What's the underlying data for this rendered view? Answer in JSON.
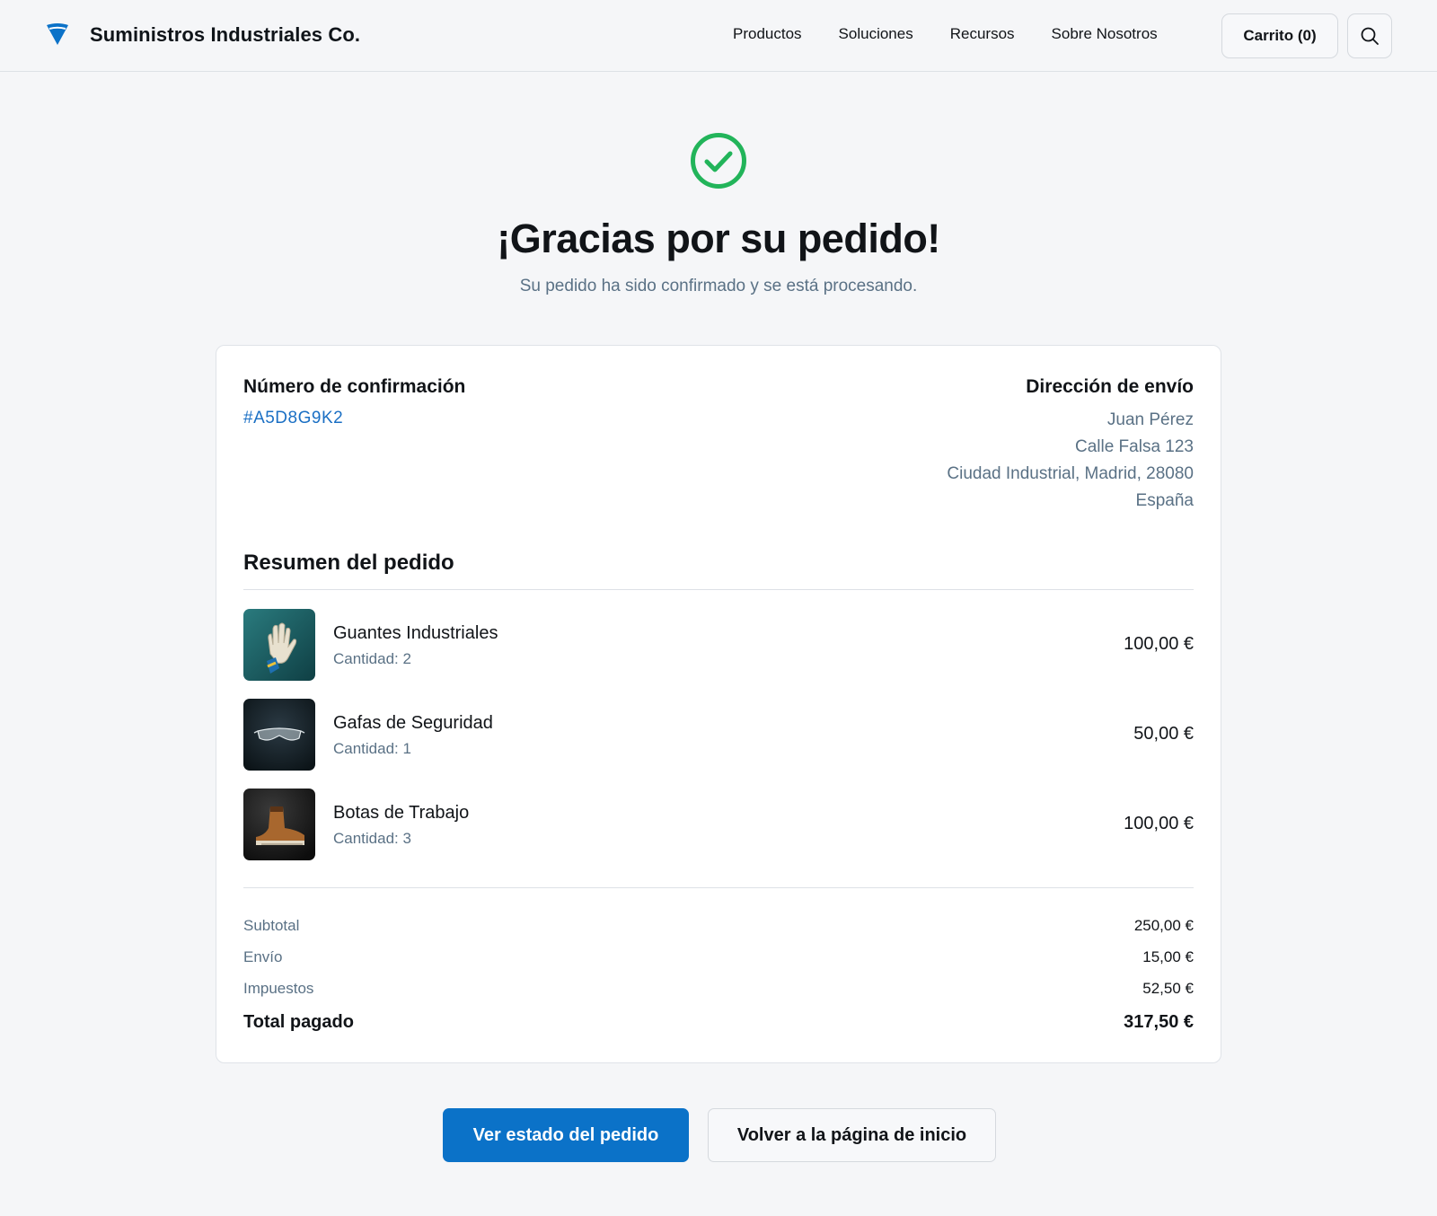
{
  "header": {
    "brand_name": "Suministros Industriales Co.",
    "logo_icon": "shield-funnel-logo",
    "nav": [
      "Productos",
      "Soluciones",
      "Recursos",
      "Sobre Nosotros"
    ],
    "cart_label": "Carrito (0)",
    "search_icon": "search-icon"
  },
  "hero": {
    "icon": "check-circle-icon",
    "title": "¡Gracias por su pedido!",
    "subtitle": "Su pedido ha sido confirmado y se está procesando."
  },
  "order": {
    "confirmation_label": "Número de confirmación",
    "confirmation_number": "#A5D8G9K2",
    "shipping_label": "Dirección de envío",
    "shipping": {
      "name": "Juan Pérez",
      "street": "Calle Falsa 123",
      "city": "Ciudad Industrial, Madrid, 28080",
      "country": "España"
    },
    "summary_title": "Resumen del pedido",
    "items": [
      {
        "name": "Guantes Industriales",
        "qty": "Cantidad: 2",
        "price": "100,00 €",
        "image": "gloves-image"
      },
      {
        "name": "Gafas de Seguridad",
        "qty": "Cantidad: 1",
        "price": "50,00 €",
        "image": "safety-glasses-image"
      },
      {
        "name": "Botas de Trabajo",
        "qty": "Cantidad: 3",
        "price": "100,00 €",
        "image": "work-boots-image"
      }
    ],
    "totals": {
      "subtotal_label": "Subtotal",
      "subtotal": "250,00 €",
      "shipping_label": "Envío",
      "shipping": "15,00 €",
      "tax_label": "Impuestos",
      "tax": "52,50 €",
      "total_label": "Total pagado",
      "total": "317,50 €"
    }
  },
  "actions": {
    "primary": "Ver estado del pedido",
    "secondary": "Volver a la página de inicio"
  },
  "colors": {
    "accent": "#0b72c8",
    "success": "#22b45a",
    "muted_text": "#5a7185"
  }
}
